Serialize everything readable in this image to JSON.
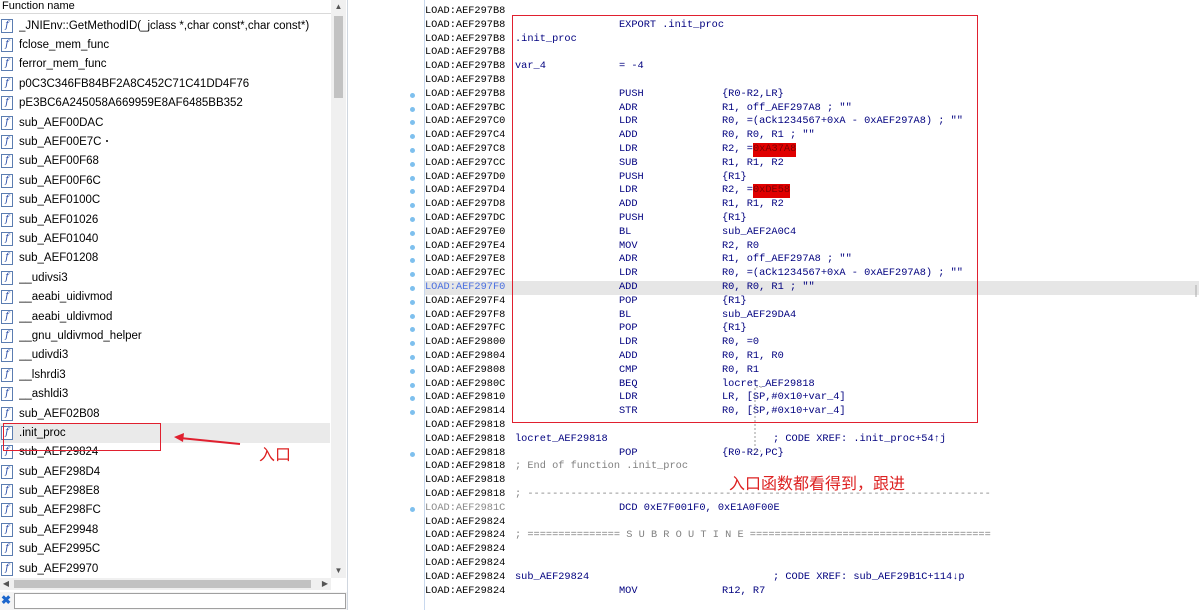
{
  "left_panel": {
    "header": "Function name",
    "functions": [
      {
        "label": "_JNIEnv::GetMethodID(_jclass *,char const*,char const*)"
      },
      {
        "label": "fclose_mem_func"
      },
      {
        "label": "ferror_mem_func"
      },
      {
        "label": "p0C3C346FB84BF2A8C452C71C41DD4F76"
      },
      {
        "label": "pE3BC6A245058A669959E8AF6485BB352"
      },
      {
        "label": "sub_AEF00DAC"
      },
      {
        "label": "sub_AEF00E7C"
      },
      {
        "label": "sub_AEF00F68"
      },
      {
        "label": "sub_AEF00F6C"
      },
      {
        "label": "sub_AEF0100C"
      },
      {
        "label": "sub_AEF01026"
      },
      {
        "label": "sub_AEF01040"
      },
      {
        "label": "sub_AEF01208"
      },
      {
        "label": "__udivsi3"
      },
      {
        "label": "__aeabi_uidivmod"
      },
      {
        "label": "__aeabi_uldivmod"
      },
      {
        "label": "__gnu_uldivmod_helper"
      },
      {
        "label": "__udivdi3"
      },
      {
        "label": "__lshrdi3"
      },
      {
        "label": "__ashldi3"
      },
      {
        "label": "sub_AEF02B08"
      },
      {
        "label": ".init_proc"
      },
      {
        "label": "sub_AEF29824"
      },
      {
        "label": "sub_AEF298D4"
      },
      {
        "label": "sub_AEF298E8"
      },
      {
        "label": "sub_AEF298FC"
      },
      {
        "label": "sub_AEF29948"
      },
      {
        "label": "sub_AEF2995C"
      },
      {
        "label": "sub_AEF29970"
      }
    ],
    "selected": ".init_proc",
    "function_icon": "function-f-icon",
    "filter_icon": "close-x-icon",
    "filter_value": ""
  },
  "annotations": {
    "entry_label": "入口",
    "follow_label": "入口函数都看得到，跟进",
    "color": "#e0202f"
  },
  "disasm": {
    "lines": [
      {
        "addr": "LOAD:AEF297B8",
        "a": "",
        "b": "",
        "c": ""
      },
      {
        "addr": "LOAD:AEF297B8",
        "a": "",
        "b": "EXPORT .init_proc",
        "c": ""
      },
      {
        "addr": "LOAD:AEF297B8",
        "a": ".init_proc",
        "b": "",
        "c": ""
      },
      {
        "addr": "LOAD:AEF297B8",
        "a": "",
        "b": "",
        "c": ""
      },
      {
        "addr": "LOAD:AEF297B8",
        "a": "var_4",
        "b": "= -4",
        "c": ""
      },
      {
        "addr": "LOAD:AEF297B8",
        "a": "",
        "b": "",
        "c": ""
      },
      {
        "addr": "LOAD:AEF297B8",
        "a": "",
        "b": "PUSH",
        "c": "{R0-R2,LR}"
      },
      {
        "addr": "LOAD:AEF297BC",
        "a": "",
        "b": "ADR",
        "c": "R1, off_AEF297A8 ; \"\""
      },
      {
        "addr": "LOAD:AEF297C0",
        "a": "",
        "b": "LDR",
        "c": "R0, =(aCk1234567+0xA - 0xAEF297A8) ; \"\""
      },
      {
        "addr": "LOAD:AEF297C4",
        "a": "",
        "b": "ADD",
        "c": "R0, R0, R1 ; \"\""
      },
      {
        "addr": "LOAD:AEF297C8",
        "a": "",
        "b": "LDR",
        "c": "R2, =",
        "red": "0xA37A8"
      },
      {
        "addr": "LOAD:AEF297CC",
        "a": "",
        "b": "SUB",
        "c": "R1, R1, R2"
      },
      {
        "addr": "LOAD:AEF297D0",
        "a": "",
        "b": "PUSH",
        "c": "{R1}"
      },
      {
        "addr": "LOAD:AEF297D4",
        "a": "",
        "b": "LDR",
        "c": "R2, =",
        "red": "0xDE58"
      },
      {
        "addr": "LOAD:AEF297D8",
        "a": "",
        "b": "ADD",
        "c": "R1, R1, R2"
      },
      {
        "addr": "LOAD:AEF297DC",
        "a": "",
        "b": "PUSH",
        "c": "{R1}"
      },
      {
        "addr": "LOAD:AEF297E0",
        "a": "",
        "b": "BL",
        "c": "sub_AEF2A0C4"
      },
      {
        "addr": "LOAD:AEF297E4",
        "a": "",
        "b": "MOV",
        "c": "R2, R0"
      },
      {
        "addr": "LOAD:AEF297E8",
        "a": "",
        "b": "ADR",
        "c": "R1, off_AEF297A8 ; \"\""
      },
      {
        "addr": "LOAD:AEF297EC",
        "a": "",
        "b": "LDR",
        "c": "R0, =(aCk1234567+0xA - 0xAEF297A8) ; \"\""
      },
      {
        "addr": "LOAD:AEF297F0",
        "a": "",
        "b": "ADD",
        "c": "R0, R0, R1 ; \"\"",
        "hl": true
      },
      {
        "addr": "LOAD:AEF297F4",
        "a": "",
        "b": "POP",
        "c": "{R1}"
      },
      {
        "addr": "LOAD:AEF297F8",
        "a": "",
        "b": "BL",
        "c": "sub_AEF29DA4"
      },
      {
        "addr": "LOAD:AEF297FC",
        "a": "",
        "b": "POP",
        "c": "{R1}"
      },
      {
        "addr": "LOAD:AEF29800",
        "a": "",
        "b": "LDR",
        "c": "R0, =0"
      },
      {
        "addr": "LOAD:AEF29804",
        "a": "",
        "b": "ADD",
        "c": "R0, R1, R0"
      },
      {
        "addr": "LOAD:AEF29808",
        "a": "",
        "b": "CMP",
        "c": "R0, R1"
      },
      {
        "addr": "LOAD:AEF2980C",
        "a": "",
        "b": "BEQ",
        "c": "locret_AEF29818"
      },
      {
        "addr": "LOAD:AEF29810",
        "a": "",
        "b": "LDR",
        "c": "LR, [SP,#0x10+var_4]"
      },
      {
        "addr": "LOAD:AEF29814",
        "a": "",
        "b": "STR",
        "c": "R0, [SP,#0x10+var_4]"
      },
      {
        "addr": "LOAD:AEF29818",
        "a": "",
        "b": "",
        "c": ""
      },
      {
        "addr": "LOAD:AEF29818",
        "a": "locret_AEF29818",
        "b": "",
        "c": "",
        "xref": "; CODE XREF: .init_proc+54↑j"
      },
      {
        "addr": "LOAD:AEF29818",
        "a": "",
        "b": "POP",
        "c": "{R0-R2,PC}"
      },
      {
        "addr": "LOAD:AEF29818",
        "a": "",
        "b": "",
        "c": "",
        "full_cmt": "; End of function .init_proc"
      },
      {
        "addr": "LOAD:AEF29818",
        "a": "",
        "b": "",
        "c": ""
      },
      {
        "addr": "LOAD:AEF29818",
        "a": "",
        "b": "",
        "c": "",
        "full_cmt": "; ---------------------------------------------------------------------------"
      },
      {
        "addr": "LOAD:AEF2981C",
        "a": "",
        "b": "DCD 0xE7F001F0, 0xE1A0F00E",
        "c": "",
        "gray": true
      },
      {
        "addr": "LOAD:AEF29824",
        "a": "",
        "b": "",
        "c": ""
      },
      {
        "addr": "LOAD:AEF29824",
        "a": "",
        "b": "",
        "c": "",
        "full_cmt": "; =============== S U B R O U T I N E ======================================="
      },
      {
        "addr": "LOAD:AEF29824",
        "a": "",
        "b": "",
        "c": ""
      },
      {
        "addr": "LOAD:AEF29824",
        "a": "",
        "b": "",
        "c": ""
      },
      {
        "addr": "LOAD:AEF29824",
        "a": "sub_AEF29824",
        "b": "",
        "c": "",
        "xref": "; CODE XREF: sub_AEF29B1C+114↓p"
      },
      {
        "addr": "LOAD:AEF29824",
        "a": "",
        "b": "MOV",
        "c": "R12, R7"
      }
    ]
  }
}
